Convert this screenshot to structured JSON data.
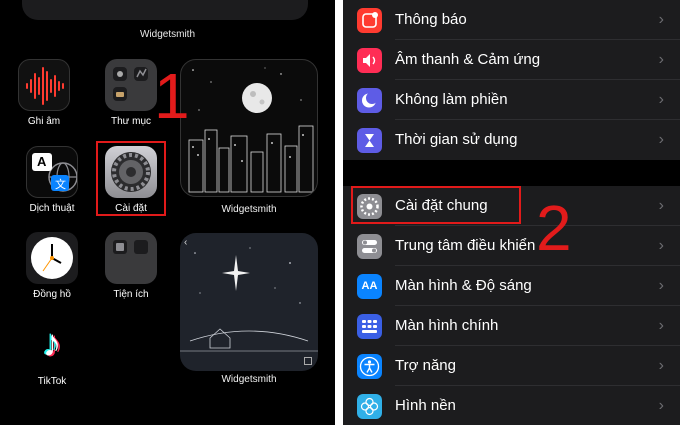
{
  "left_screen": {
    "widget_top_label": "Widgetsmith",
    "apps": {
      "voice_memos": "Ghi âm",
      "folder": "Thư mục",
      "translate": "Dịch thuật",
      "settings": "Cài đặt",
      "clock": "Đồng hồ",
      "utilities": "Tiện ích",
      "tiktok": "TikTok"
    },
    "widget_moon_label": "Widgetsmith",
    "widget_star_label": "Widgetsmith",
    "translate_glyph_a": "A",
    "translate_glyph_b": "文",
    "tiktok_glyph": "♪"
  },
  "right_screen": {
    "group1": [
      {
        "label": "Thông báo",
        "icon": "notifications-icon",
        "color": "#ff3b30"
      },
      {
        "label": "Âm thanh & Cảm ứng",
        "icon": "sound-icon",
        "color": "#ff2d55"
      },
      {
        "label": "Không làm phiền",
        "icon": "moon-icon",
        "color": "#5e5ce6"
      },
      {
        "label": "Thời gian sử dụng",
        "icon": "hourglass-icon",
        "color": "#5e5ce6"
      }
    ],
    "group2": [
      {
        "label": "Cài đặt chung",
        "icon": "gear-icon",
        "color": "#8e8e93"
      },
      {
        "label": "Trung tâm điều khiển",
        "icon": "toggles-icon",
        "color": "#8e8e93"
      },
      {
        "label": "Màn hình & Độ sáng",
        "icon": "display-icon",
        "color": "#0a84ff",
        "glyph": "AA"
      },
      {
        "label": "Màn hình chính",
        "icon": "home-grid-icon",
        "color": "#3a5fe5"
      },
      {
        "label": "Trợ năng",
        "icon": "accessibility-icon",
        "color": "#0a84ff"
      },
      {
        "label": "Hình nền",
        "icon": "wallpaper-icon",
        "color": "#30b0e8"
      }
    ],
    "chevron": "›"
  },
  "annotations": {
    "step1": "1",
    "step2": "2",
    "color": "#e11a1a"
  }
}
